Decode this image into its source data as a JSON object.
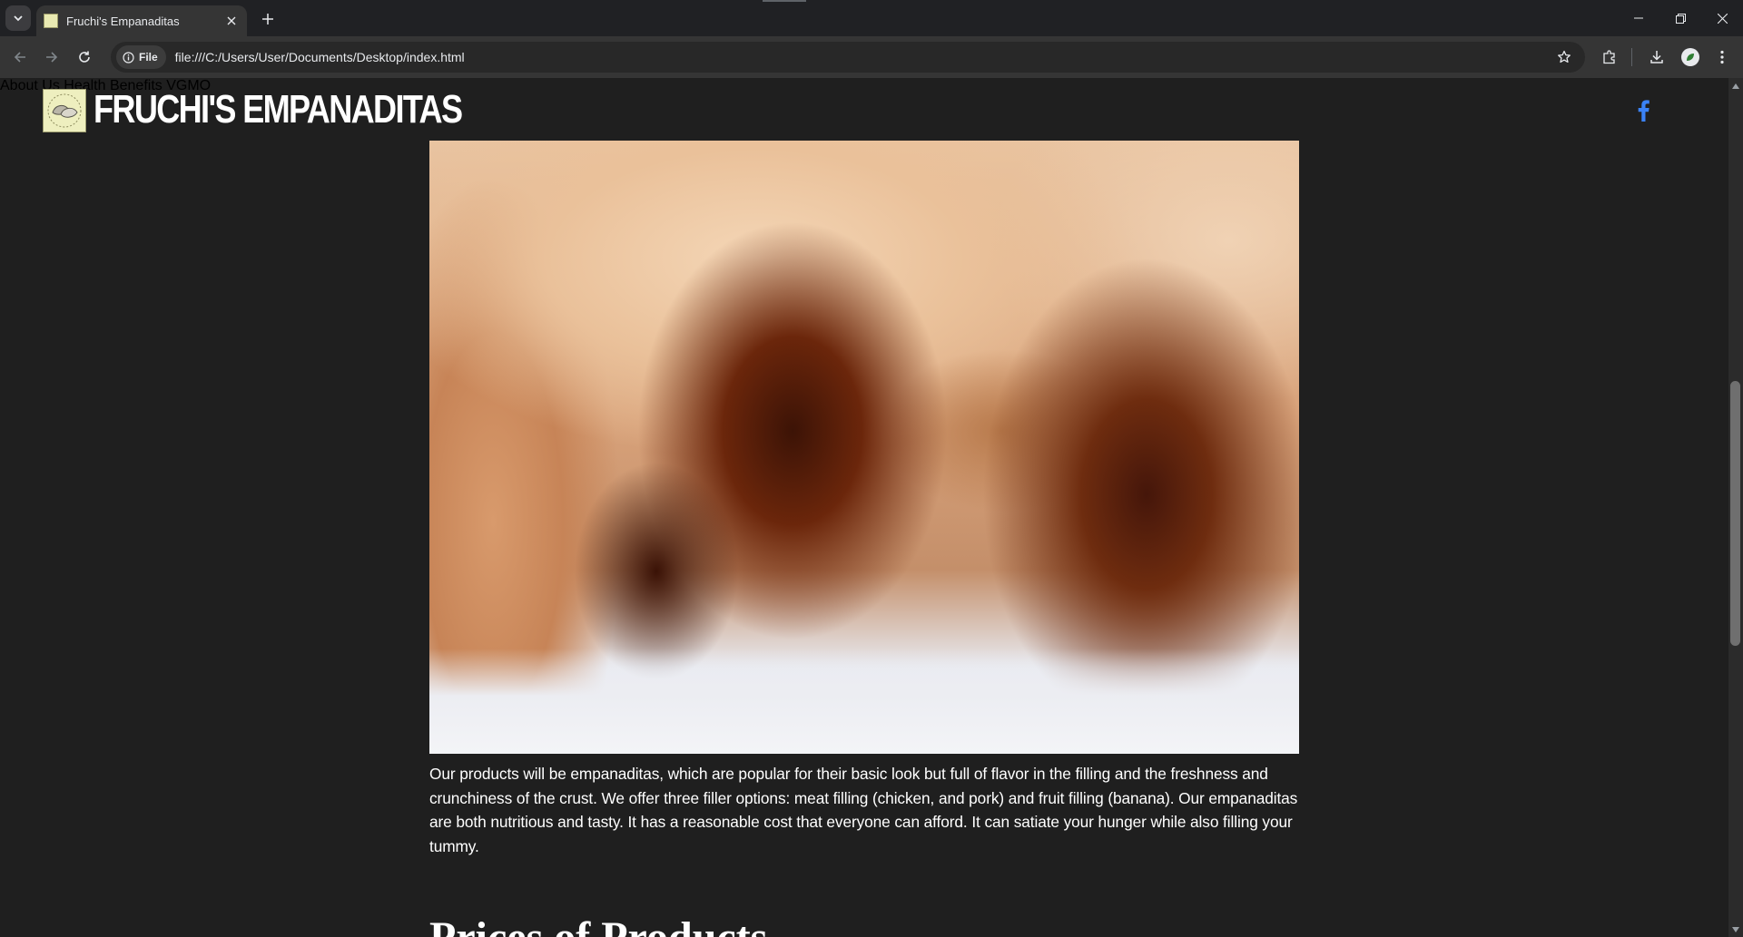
{
  "browser": {
    "tab_title": "Fruchi's Empanaditas",
    "chip_label": "File",
    "url": "file:///C:/Users/User/Documents/Desktop/index.html"
  },
  "site": {
    "brand": "FRUCHI'S EMPANADITAS",
    "nav": [
      "About Us",
      "Health Benefits",
      "VGMO"
    ],
    "description": "Our products will be empanaditas, which are popular for their basic look but full of flavor in the filling and the freshness and crunchiness of the crust. We offer three filler options: meat filling (chicken, and pork) and fruit filling (banana). Our empanaditas are both nutritious and tasty. It has a reasonable cost that everyone can afford. It can satiate your hunger while also filling your tummy.",
    "next_heading": "Prices of Products"
  },
  "colors": {
    "page_bg": "#1f1f1f",
    "facebook": "#3b82f6"
  }
}
